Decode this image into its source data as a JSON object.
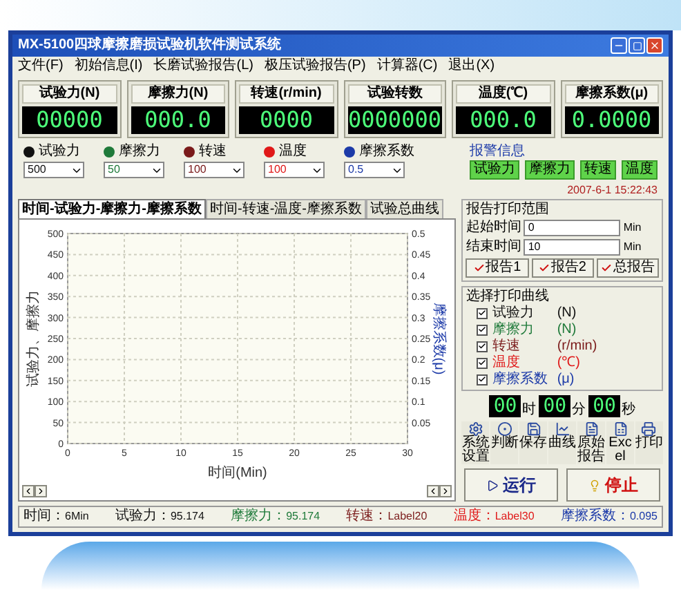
{
  "window": {
    "title": "MX-5100四球摩擦磨损试验机软件测试系统"
  },
  "menu": [
    {
      "label": "文件(F)"
    },
    {
      "label": "初始信息(I)"
    },
    {
      "label": "长磨试验报告(L)"
    },
    {
      "label": "极压试验报告(P)"
    },
    {
      "label": "计算器(C)"
    },
    {
      "label": "退出(X)"
    }
  ],
  "readouts": [
    {
      "label": "试验力(N)",
      "value": "00000"
    },
    {
      "label": "摩擦力(N)",
      "value": "000.0"
    },
    {
      "label": "转速(r/min)",
      "value": "0000"
    },
    {
      "label": "试验转数",
      "value": "0000000"
    },
    {
      "label": "温度(℃)",
      "value": "000.0"
    },
    {
      "label": "摩擦系数(μ)",
      "value": "0.0000"
    }
  ],
  "scales": [
    {
      "name": "试验力",
      "color": "#111111",
      "value": "500"
    },
    {
      "name": "摩擦力",
      "color": "#1f7a3a",
      "value": "50"
    },
    {
      "name": "转速",
      "color": "#7a1a1a",
      "value": "100"
    },
    {
      "name": "温度",
      "color": "#e01818",
      "value": "100"
    },
    {
      "name": "摩擦系数",
      "color": "#1c3aa8",
      "value": "0.5"
    }
  ],
  "alarm": {
    "title": "报警信息",
    "indicators": [
      {
        "label": "试验力"
      },
      {
        "label": "摩擦力"
      },
      {
        "label": "转速"
      },
      {
        "label": "温度"
      }
    ]
  },
  "datetime": "2007-6-1 15:22:43",
  "tabs": [
    {
      "label": "时间-试验力-摩擦力-摩擦系数",
      "selected": true
    },
    {
      "label": "时间-转速-温度-摩擦系数",
      "selected": false
    },
    {
      "label": "试验总曲线",
      "selected": false
    }
  ],
  "chart": {
    "chart_data": {
      "type": "line",
      "grid": true,
      "xlabel": "时间(Min)",
      "ylabel": "试验力、摩擦力",
      "xlim": [
        0,
        30
      ],
      "ylim": [
        0,
        500
      ],
      "xticks": [
        0,
        5,
        10,
        15,
        20,
        25,
        30
      ],
      "yticks": [
        0,
        50,
        100,
        150,
        200,
        250,
        300,
        350,
        400,
        450,
        500
      ]
    },
    "right_axis": {
      "label": "摩擦系数(μ)",
      "ticks": [
        "0.5",
        "0.45",
        "0.4",
        "0.35",
        "0.3",
        "0.25",
        "0.2",
        "0.15",
        "0.1",
        "0.05"
      ]
    }
  },
  "status_bar": [
    {
      "label": "时间：",
      "value": "6Min",
      "color": "#111111"
    },
    {
      "label": "试验力：",
      "value": "95.174",
      "color": "#111111"
    },
    {
      "label": "摩擦力：",
      "value": "95.174",
      "color": "#1f7a3a"
    },
    {
      "label": "转速：",
      "value": "Label20",
      "color": "#7a1a1a"
    },
    {
      "label": "温度：",
      "value": "Label30",
      "color": "#e01818"
    },
    {
      "label": "摩擦系数：",
      "value": "0.095",
      "color": "#1c3aa8"
    }
  ],
  "report_range": {
    "title": "报告打印范围",
    "fields": [
      {
        "label": "起始时间",
        "value": "0",
        "unit": "Min"
      },
      {
        "label": "结束时间",
        "value": "10",
        "unit": "Min"
      }
    ],
    "buttons": [
      {
        "label": "报告1"
      },
      {
        "label": "报告2"
      },
      {
        "label": "总报告"
      }
    ]
  },
  "print_curves": {
    "title": "选择打印曲线",
    "items": [
      {
        "label": "试验力",
        "unit": "(N)",
        "checked": true,
        "color": "#111111"
      },
      {
        "label": "摩擦力",
        "unit": "(N)",
        "checked": true,
        "color": "#1f7a3a"
      },
      {
        "label": "转速",
        "unit": "(r/min)",
        "checked": true,
        "color": "#7a1a1a"
      },
      {
        "label": "温度",
        "unit": "(℃)",
        "checked": true,
        "color": "#e01818"
      },
      {
        "label": "摩擦系数",
        "unit": "(μ)",
        "checked": true,
        "color": "#1c3aa8"
      }
    ]
  },
  "timer": [
    {
      "value": "00",
      "unit": "时"
    },
    {
      "value": "00",
      "unit": "分"
    },
    {
      "value": "00",
      "unit": "秒"
    }
  ],
  "toolbar": [
    {
      "kind": "settings",
      "label": "系统设置"
    },
    {
      "kind": "judge",
      "label": "判断"
    },
    {
      "kind": "save",
      "label": "保存"
    },
    {
      "kind": "curve",
      "label": "曲线"
    },
    {
      "kind": "report",
      "label": "原始报告"
    },
    {
      "kind": "excel",
      "label": "Excel"
    },
    {
      "kind": "print",
      "label": "打印"
    }
  ],
  "actions": [
    {
      "kind": "run",
      "label": "运行"
    },
    {
      "kind": "stop",
      "label": "停止"
    }
  ]
}
